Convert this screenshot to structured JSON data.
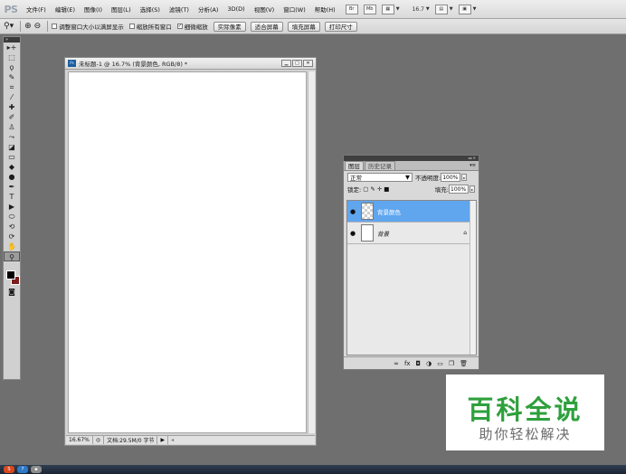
{
  "app": {
    "logo": "PS",
    "menu": [
      "文件(F)",
      "编辑(E)",
      "图像(I)",
      "图层(L)",
      "选择(S)",
      "滤镜(T)",
      "分析(A)",
      "3D(D)",
      "视图(V)",
      "窗口(W)",
      "帮助(H)"
    ],
    "bar_icons": [
      "Br",
      "Mb"
    ],
    "zoom_value": "16.7"
  },
  "options_bar": {
    "checkboxes": [
      {
        "label": "调整窗口大小以满屏显示",
        "checked": false
      },
      {
        "label": "缩放所有窗口",
        "checked": false
      },
      {
        "label": "细微缩放",
        "checked": true
      }
    ],
    "buttons": [
      "实际像素",
      "适合屏幕",
      "填充屏幕",
      "打印尺寸"
    ]
  },
  "toolbox": {
    "tools": [
      {
        "name": "move-tool-icon",
        "glyph": "▸+"
      },
      {
        "name": "marquee-tool-icon",
        "glyph": "⬚"
      },
      {
        "name": "lasso-tool-icon",
        "glyph": "ϙ"
      },
      {
        "name": "quick-select-tool-icon",
        "glyph": "✎"
      },
      {
        "name": "crop-tool-icon",
        "glyph": "⌗"
      },
      {
        "name": "eyedropper-tool-icon",
        "glyph": "⁄"
      },
      {
        "name": "healing-brush-tool-icon",
        "glyph": "✚"
      },
      {
        "name": "brush-tool-icon",
        "glyph": "✐"
      },
      {
        "name": "stamp-tool-icon",
        "glyph": "♙"
      },
      {
        "name": "history-brush-tool-icon",
        "glyph": "⤳"
      },
      {
        "name": "eraser-tool-icon",
        "glyph": "◪"
      },
      {
        "name": "gradient-tool-icon",
        "glyph": "▭"
      },
      {
        "name": "blur-tool-icon",
        "glyph": "◆"
      },
      {
        "name": "dodge-tool-icon",
        "glyph": "●"
      },
      {
        "name": "pen-tool-icon",
        "glyph": "✒"
      },
      {
        "name": "type-tool-icon",
        "glyph": "T"
      },
      {
        "name": "path-select-tool-icon",
        "glyph": "▶"
      },
      {
        "name": "shape-tool-icon",
        "glyph": "⬭"
      },
      {
        "name": "3d-rotate-tool-icon",
        "glyph": "⟲"
      },
      {
        "name": "3d-orbit-tool-icon",
        "glyph": "⟳"
      },
      {
        "name": "hand-tool-icon",
        "glyph": "✋"
      },
      {
        "name": "zoom-tool-icon",
        "glyph": "⚲"
      }
    ],
    "active_tool": "zoom-tool-icon",
    "foreground_color": "#000000",
    "background_color": "#7b1e1e"
  },
  "document": {
    "title": "未标题-1 @ 16.7% (背景颜色, RGB/8) *",
    "zoom_status": "16.67%",
    "doc_info": "文档:29.5M/0 字节"
  },
  "layers_panel": {
    "tabs": [
      "图层",
      "历史记录"
    ],
    "active_tab": "图层",
    "blend_mode": "正常",
    "opacity_label": "不透明度:",
    "opacity_value": "100%",
    "lock_label": "锁定:",
    "fill_label": "填充:",
    "fill_value": "100%",
    "layers": [
      {
        "name": "背景颜色",
        "selected": true,
        "visible": true,
        "locked": false
      },
      {
        "name": "背景",
        "selected": false,
        "visible": true,
        "locked": true
      }
    ]
  },
  "watermark": {
    "title": "百科全说",
    "subtitle": "助你轻松解决"
  },
  "colors": {
    "selection_blue": "#5fa6ef",
    "watermark_green": "#2ea03c"
  }
}
